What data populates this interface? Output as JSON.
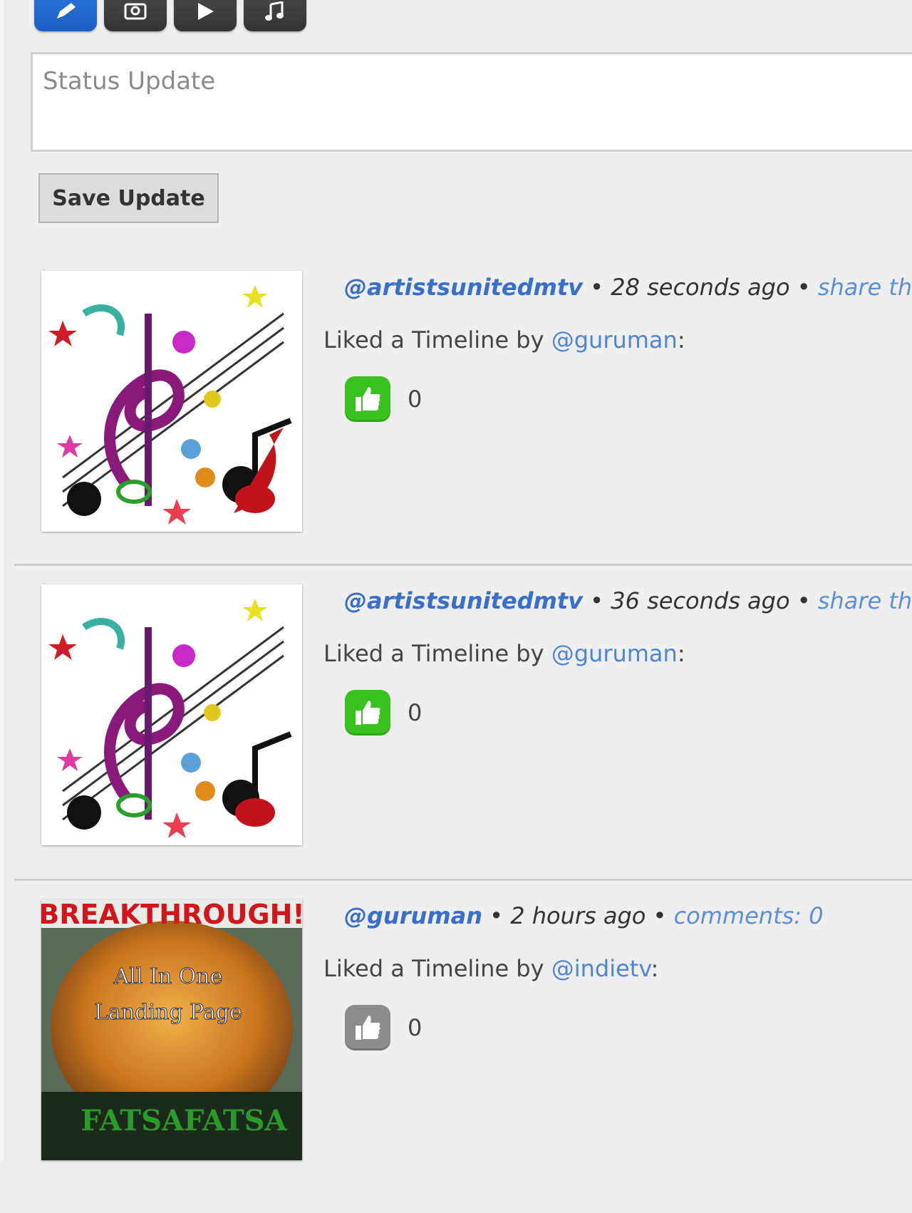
{
  "toolbar": {
    "buttons": [
      {
        "name": "pencil-icon",
        "active": true
      },
      {
        "name": "camera-icon",
        "active": false
      },
      {
        "name": "play-icon",
        "active": false
      },
      {
        "name": "music-note-icon",
        "active": false
      }
    ]
  },
  "status": {
    "placeholder": "Status Update",
    "save_label": "Save Update"
  },
  "feed": [
    {
      "user": "@artistsunitedmtv",
      "time": "28 seconds ago",
      "link": "share th",
      "activity_prefix": "Liked a Timeline by ",
      "mention": "@guruman",
      "activity_suffix": ":",
      "likes": "0",
      "like_color": "green",
      "thumbnail": "music-notes-image"
    },
    {
      "user": "@artistsunitedmtv",
      "time": "36 seconds ago",
      "link": "share th",
      "activity_prefix": "Liked a Timeline by ",
      "mention": "@guruman",
      "activity_suffix": ":",
      "likes": "0",
      "like_color": "green",
      "thumbnail": "music-notes-image"
    },
    {
      "user": "@guruman",
      "time": "2 hours ago",
      "link": "comments: 0",
      "activity_prefix": "Liked a Timeline by ",
      "mention": "@indietv",
      "activity_suffix": ":",
      "likes": "0",
      "like_color": "gray",
      "thumbnail": "breakthrough-image",
      "thumbnail_text": {
        "headline": "BREAKTHROUGH!",
        "line1": "All In One",
        "line2": "Landing Page",
        "brand": "FATSAFATSA"
      }
    }
  ],
  "colors": {
    "background": "#eeeeee",
    "user_link": "#3a6fc9",
    "mention": "#4f84d6",
    "like_green": "#39c21f",
    "like_gray": "#8c8c8c",
    "active_tool": "#2f7de1"
  }
}
